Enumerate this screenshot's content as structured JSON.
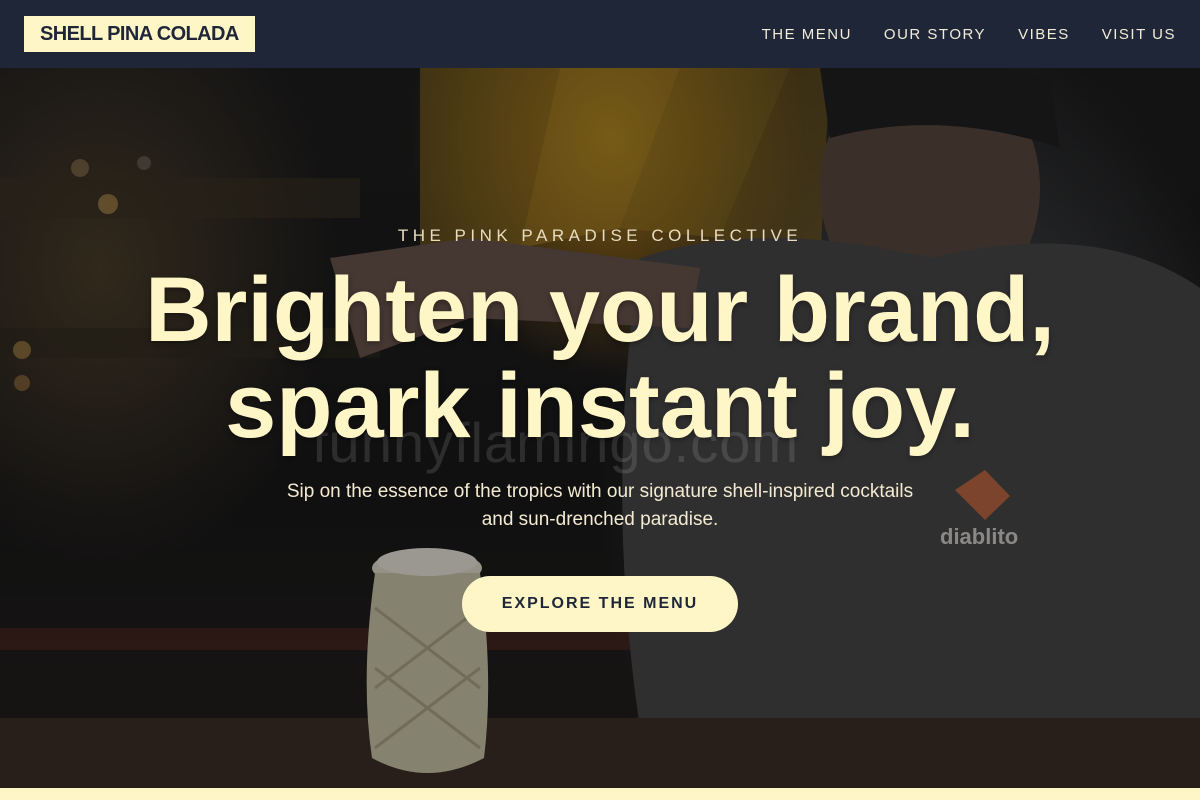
{
  "navbar": {
    "brand": "SHELL PINA COLADA",
    "links": [
      {
        "label": "THE MENU"
      },
      {
        "label": "OUR STORY"
      },
      {
        "label": "VIBES"
      },
      {
        "label": "VISIT US"
      }
    ]
  },
  "hero": {
    "eyebrow": "THE PINK PARADISE COLLECTIVE",
    "headline_line1": "Brighten your brand,",
    "headline_line2": "spark instant joy.",
    "subtext_line1": "Sip on the essence of the tropics with our signature shell-inspired cocktails",
    "subtext_line2": "and sun-drenched paradise.",
    "cta_label": "EXPLORE THE MENU",
    "watermark": "funnyflamingo.com",
    "shirt_logo": "diablito"
  },
  "colors": {
    "navbar_bg": "#1e2638",
    "accent_cream": "#fff6c8",
    "text_light": "#f2ecd8"
  }
}
